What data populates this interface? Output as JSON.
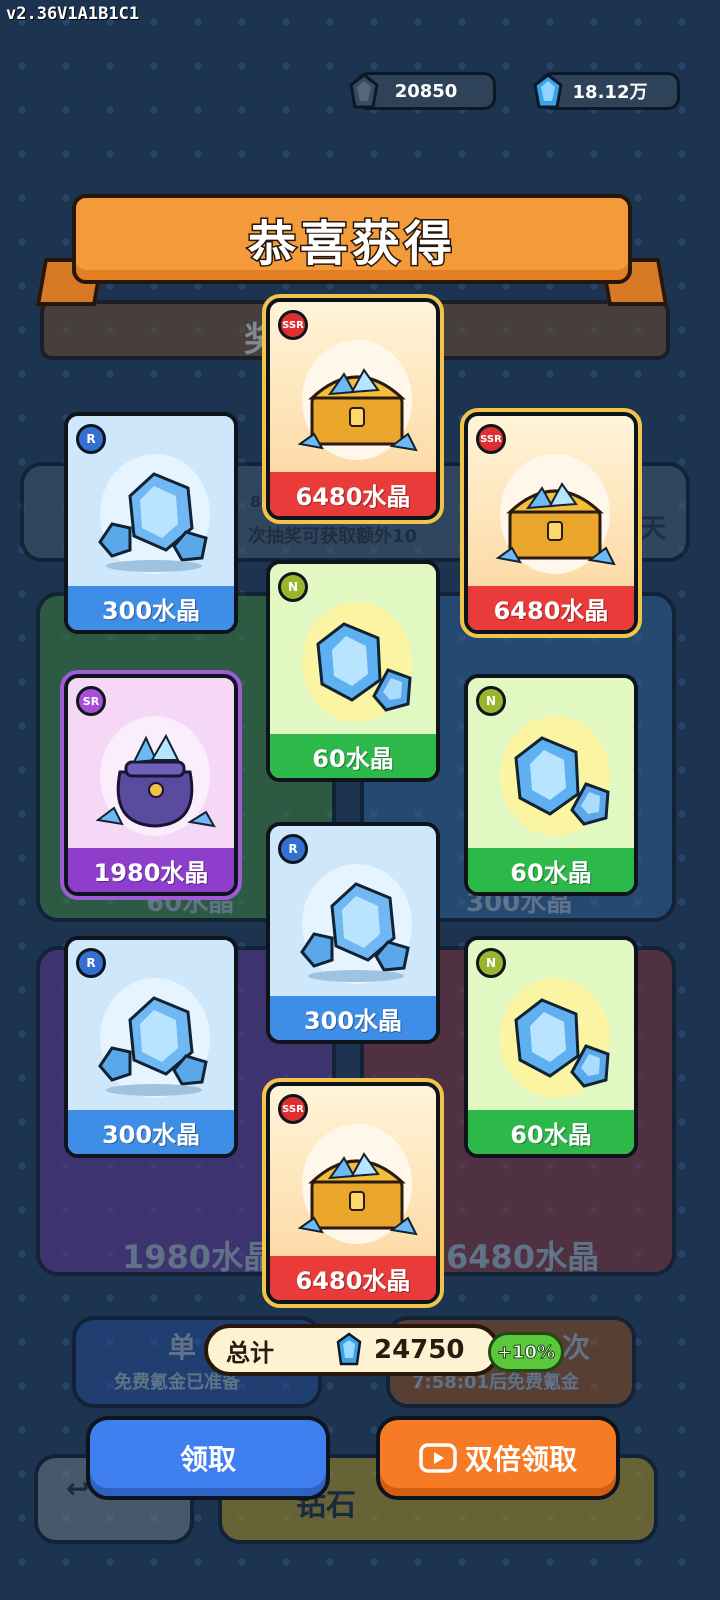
{
  "version": "v2.36V1A1B1C1",
  "currencies": [
    {
      "icon": "dark-crystal-icon",
      "value": "20850"
    },
    {
      "icon": "blue-crystal-icon",
      "value": "18.12万"
    }
  ],
  "background": {
    "banner_partial": "奖",
    "notice_line1": "8",
    "notice_line2": "次抽奖可获取额外10",
    "side_text": "天",
    "panel_values": [
      "60水晶",
      "300水晶",
      "1980水晶",
      "6480水晶"
    ],
    "single_draw": {
      "title": "单",
      "subtitle": "免费氪金已准备"
    },
    "multi_draw": {
      "title": "次",
      "subtitle": "7:58:01后免费氪金"
    },
    "bottom_buttons": [
      "↩",
      "钻石"
    ]
  },
  "reward_title": "恭喜获得",
  "rewards": [
    {
      "rarity": "SSR",
      "label": "6480水晶",
      "icon": "treasure-chest-icon"
    },
    {
      "rarity": "R",
      "label": "300水晶",
      "icon": "crystal-cluster-icon"
    },
    {
      "rarity": "SSR",
      "label": "6480水晶",
      "icon": "treasure-chest-icon"
    },
    {
      "rarity": "N",
      "label": "60水晶",
      "icon": "crystal-pair-icon"
    },
    {
      "rarity": "SR",
      "label": "1980水晶",
      "icon": "crystal-bag-icon"
    },
    {
      "rarity": "N",
      "label": "60水晶",
      "icon": "crystal-pair-icon"
    },
    {
      "rarity": "R",
      "label": "300水晶",
      "icon": "crystal-cluster-icon"
    },
    {
      "rarity": "R",
      "label": "300水晶",
      "icon": "crystal-cluster-icon"
    },
    {
      "rarity": "N",
      "label": "60水晶",
      "icon": "crystal-pair-icon"
    },
    {
      "rarity": "SSR",
      "label": "6480水晶",
      "icon": "treasure-chest-icon"
    }
  ],
  "total": {
    "label": "总计",
    "value": "24750",
    "bonus": "+10%"
  },
  "buttons": {
    "claim": "领取",
    "double_claim": "双倍领取"
  }
}
